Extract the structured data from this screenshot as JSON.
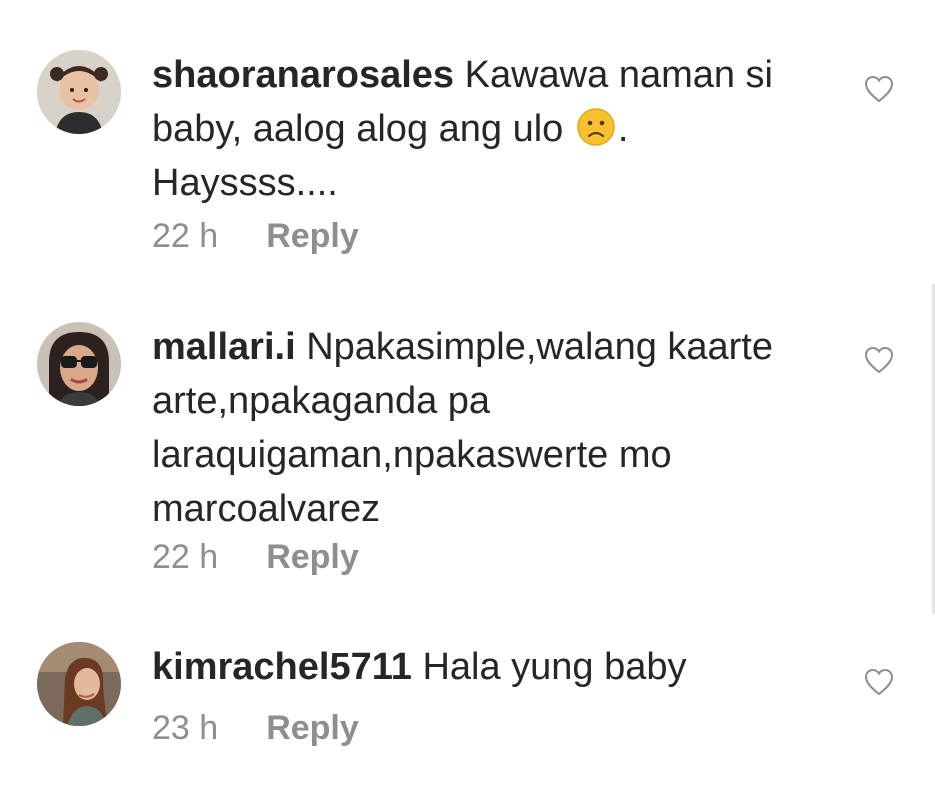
{
  "comments": [
    {
      "username": "shaoranarosales",
      "text_before_emoji": "Kawawa naman si baby, aalog alog ang ulo",
      "emoji": "slightly-frowning-face",
      "text_after_emoji": ". Hayssss....",
      "time": "22 h",
      "reply_label": "Reply"
    },
    {
      "username": "mallari.i",
      "text": "Npakasimple,walang kaarte arte,npakaganda pa laraquigaman,npakaswerte mo marcoalvarez",
      "time": "22 h",
      "reply_label": "Reply"
    },
    {
      "username": "kimrachel5711",
      "text": "Hala yung baby",
      "time": "23 h",
      "reply_label": "Reply"
    }
  ],
  "colors": {
    "text": "#262626",
    "muted": "#8e8e8e",
    "background": "#ffffff"
  }
}
